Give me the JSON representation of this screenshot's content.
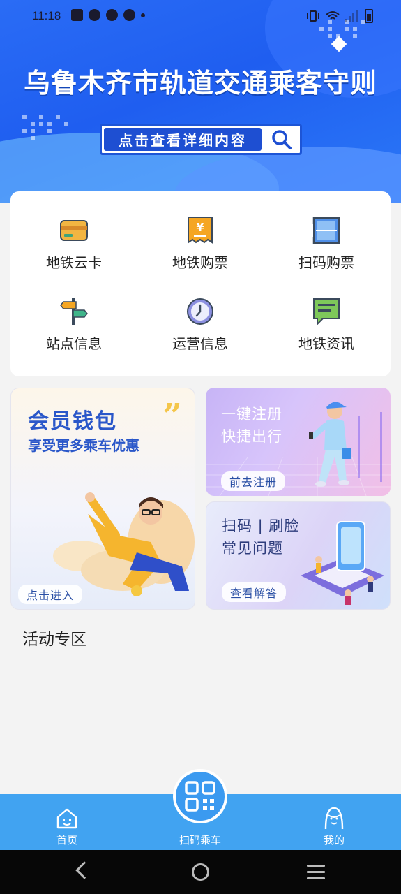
{
  "status_bar": {
    "time": "11:18"
  },
  "banner": {
    "title": "乌鲁木齐市轨道交通乘客守则",
    "search_label": "点击查看详细内容"
  },
  "grid": {
    "items": [
      {
        "label": "地铁云卡",
        "icon": "card-icon"
      },
      {
        "label": "地铁购票",
        "icon": "ticket-icon"
      },
      {
        "label": "扫码购票",
        "icon": "scan-icon"
      },
      {
        "label": "站点信息",
        "icon": "signpost-icon"
      },
      {
        "label": "运营信息",
        "icon": "clock-icon"
      },
      {
        "label": "地铁资讯",
        "icon": "news-icon"
      }
    ]
  },
  "promos": {
    "member": {
      "title": "会员钱包",
      "subtitle": "享受更多乘车优惠",
      "button": "点击进入"
    },
    "register": {
      "line1": "一键注册",
      "line2": "快捷出行",
      "button": "前去注册"
    },
    "faq": {
      "line1": "扫码 | 刷脸",
      "line2": "常见问题",
      "button": "查看解答"
    }
  },
  "section": {
    "title": "活动专区"
  },
  "tabbar": {
    "home": "首页",
    "scan": "扫码乘车",
    "mine": "我的"
  },
  "colors": {
    "banner_blue": "#1f5ef0",
    "tab_blue": "#41a3f1",
    "accent_blue": "#2a57c9"
  }
}
